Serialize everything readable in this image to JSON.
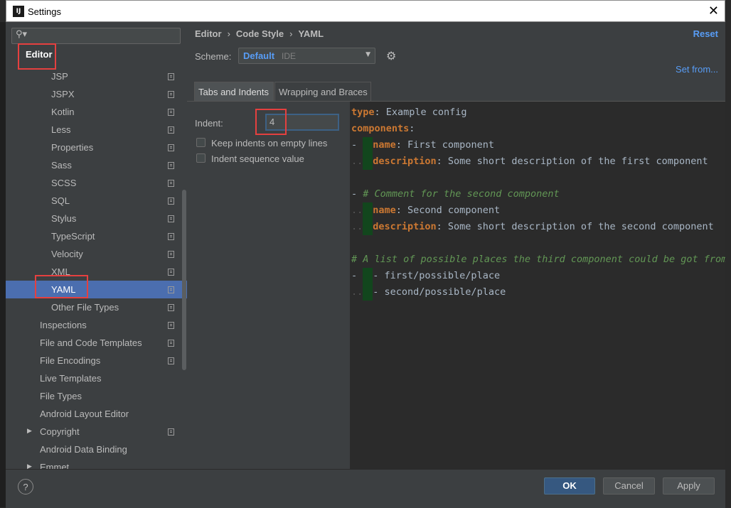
{
  "window": {
    "title": "Settings",
    "close_glyph": "✕",
    "app_icon": "IJ"
  },
  "sidebar": {
    "search_placeholder": "",
    "root_label": "Editor",
    "items": [
      {
        "label": "JSP",
        "indent": 2,
        "copy_icon": true
      },
      {
        "label": "JSPX",
        "indent": 2,
        "copy_icon": true
      },
      {
        "label": "Kotlin",
        "indent": 2,
        "copy_icon": true
      },
      {
        "label": "Less",
        "indent": 2,
        "copy_icon": true
      },
      {
        "label": "Properties",
        "indent": 2,
        "copy_icon": true
      },
      {
        "label": "Sass",
        "indent": 2,
        "copy_icon": true
      },
      {
        "label": "SCSS",
        "indent": 2,
        "copy_icon": true
      },
      {
        "label": "SQL",
        "indent": 2,
        "copy_icon": true
      },
      {
        "label": "Stylus",
        "indent": 2,
        "copy_icon": true
      },
      {
        "label": "TypeScript",
        "indent": 2,
        "copy_icon": true
      },
      {
        "label": "Velocity",
        "indent": 2,
        "copy_icon": true
      },
      {
        "label": "XML",
        "indent": 2,
        "copy_icon": true
      },
      {
        "label": "YAML",
        "indent": 2,
        "copy_icon": true,
        "selected": true
      },
      {
        "label": "Other File Types",
        "indent": 2,
        "copy_icon": true
      },
      {
        "label": "Inspections",
        "indent": 1,
        "copy_icon": true
      },
      {
        "label": "File and Code Templates",
        "indent": 1,
        "copy_icon": true
      },
      {
        "label": "File Encodings",
        "indent": 1,
        "copy_icon": true
      },
      {
        "label": "Live Templates",
        "indent": 1,
        "copy_icon": false
      },
      {
        "label": "File Types",
        "indent": 1,
        "copy_icon": false
      },
      {
        "label": "Android Layout Editor",
        "indent": 1,
        "copy_icon": false
      },
      {
        "label": "Copyright",
        "indent": 1,
        "copy_icon": true,
        "expandable": true
      },
      {
        "label": "Android Data Binding",
        "indent": 1,
        "copy_icon": false
      },
      {
        "label": "Emmet",
        "indent": 1,
        "copy_icon": false,
        "expandable": true
      }
    ]
  },
  "header": {
    "breadcrumb": [
      "Editor",
      "Code Style",
      "YAML"
    ],
    "breadcrumb_sep": "›",
    "reset_label": "Reset",
    "scheme_label": "Scheme:",
    "scheme_value": "Default",
    "scheme_sub": "IDE",
    "set_from_label": "Set from..."
  },
  "tabs": [
    {
      "label": "Tabs and Indents",
      "active": true
    },
    {
      "label": "Wrapping and Braces",
      "active": false
    }
  ],
  "options": {
    "indent_label": "Indent:",
    "indent_value": "4",
    "keep_indents_label": "Keep indents on empty lines",
    "keep_indents_checked": false,
    "indent_sequence_label": "Indent sequence value",
    "indent_sequence_checked": false
  },
  "preview": {
    "lines": [
      [
        {
          "t": "type",
          "s": "k"
        },
        {
          "t": ": Example config"
        }
      ],
      [
        {
          "t": "components",
          "s": "k"
        },
        {
          "t": ":"
        }
      ],
      [
        {
          "t": "- ",
          "s": ""
        },
        {
          "t": "",
          "s": "ib"
        },
        {
          "t": "name",
          "s": "k"
        },
        {
          "t": ": First component"
        }
      ],
      [
        {
          "t": "..",
          "s": "dot"
        },
        {
          "t": "",
          "s": "ib"
        },
        {
          "t": "description",
          "s": "k"
        },
        {
          "t": ": Some short description of the first component"
        }
      ],
      [],
      [
        {
          "t": "- "
        },
        {
          "t": "# Comment for the second component",
          "s": "c"
        }
      ],
      [
        {
          "t": "..",
          "s": "dot"
        },
        {
          "t": "",
          "s": "ib"
        },
        {
          "t": "name",
          "s": "k"
        },
        {
          "t": ": Second component"
        }
      ],
      [
        {
          "t": "..",
          "s": "dot"
        },
        {
          "t": "",
          "s": "ib"
        },
        {
          "t": "description",
          "s": "k"
        },
        {
          "t": ": Some short description of the second component"
        }
      ],
      [],
      [
        {
          "t": "# A list of possible places the third component could be got from",
          "s": "c"
        }
      ],
      [
        {
          "t": "- "
        },
        {
          "t": "",
          "s": "ib"
        },
        {
          "t": "- first/possible/place"
        }
      ],
      [
        {
          "t": "..",
          "s": "dot"
        },
        {
          "t": "",
          "s": "ib"
        },
        {
          "t": "- second/possible/place"
        }
      ]
    ]
  },
  "footer": {
    "help_label": "?",
    "ok_label": "OK",
    "cancel_label": "Cancel",
    "apply_label": "Apply"
  },
  "colors": {
    "accent": "#589df6",
    "selection": "#4b6eaf",
    "keyword": "#cc7832",
    "comment": "#629755",
    "highlight": "#e5403f"
  }
}
